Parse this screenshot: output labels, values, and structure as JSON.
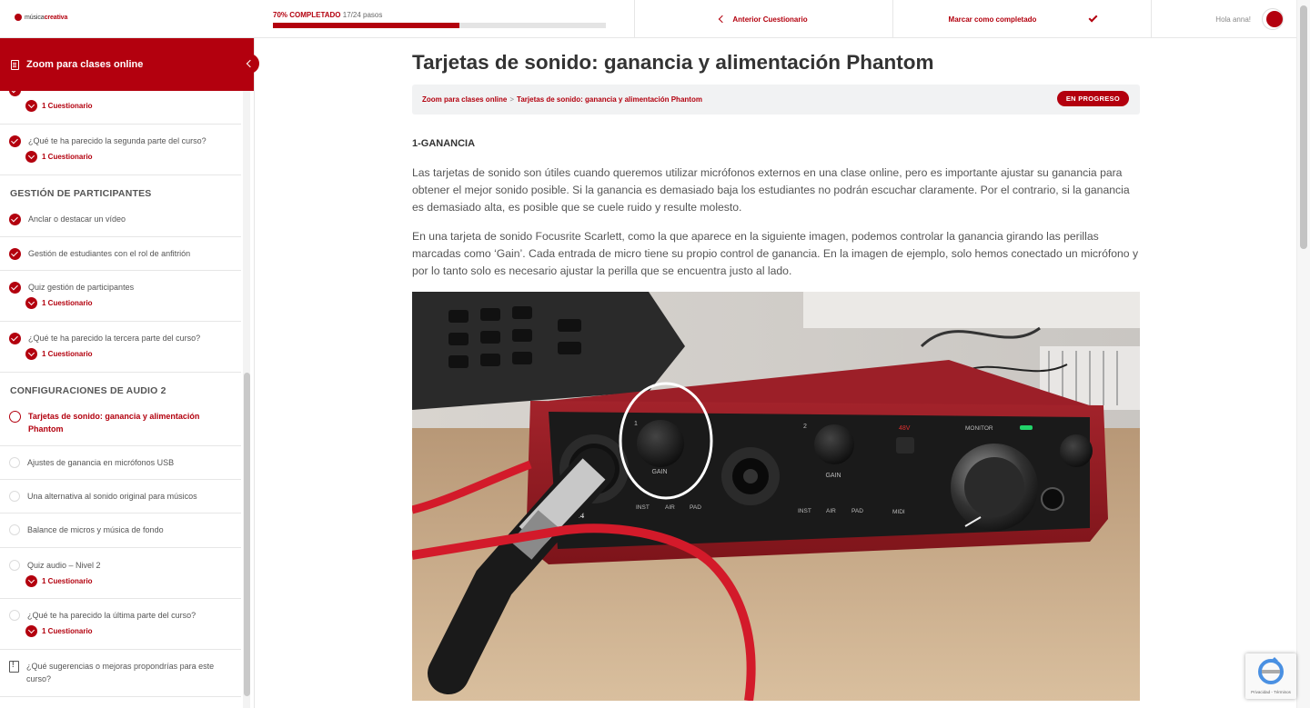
{
  "brand": {
    "logo_text_light": "música",
    "logo_text_bold": "creativa"
  },
  "progress": {
    "percent_label": "70% COMPLETADO",
    "steps_label": "17/24 pasos",
    "fraction": 0.7
  },
  "nav": {
    "prev_label": "Anterior Cuestionario",
    "complete_label": "Marcar como completado",
    "greeting": "Hola anna!"
  },
  "sidebar": {
    "course_title": "Zoom para clases online",
    "partial_top_quiz": "1 Cuestionario",
    "lessons_a": [
      {
        "title": "¿Qué te ha parecido la segunda parte del curso?",
        "quiz": "1 Cuestionario"
      }
    ],
    "section_1": "GESTIÓN DE PARTICIPANTES",
    "lessons_b": [
      {
        "title": "Anclar o destacar un vídeo"
      },
      {
        "title": "Gestión de estudiantes con el rol de anfitrión"
      },
      {
        "title": "Quiz gestión de participantes",
        "quiz": "1 Cuestionario"
      },
      {
        "title": "¿Qué te ha parecido la tercera parte del curso?",
        "quiz": "1 Cuestionario"
      }
    ],
    "section_2": "CONFIGURACIONES DE AUDIO 2",
    "lessons_c": [
      {
        "title": "Tarjetas de sonido: ganancia y alimentación Phantom"
      },
      {
        "title": "Ajustes de ganancia en micrófonos USB"
      },
      {
        "title": "Una alternativa al sonido original para músicos"
      },
      {
        "title": "Balance de micros y música de fondo"
      },
      {
        "title": "Quiz audio – Nivel 2",
        "quiz": "1 Cuestionario"
      },
      {
        "title": "¿Qué te ha parecido la última parte del curso?",
        "quiz": "1 Cuestionario"
      },
      {
        "title": "¿Qué sugerencias o mejoras propondrías para este curso?"
      }
    ]
  },
  "main": {
    "title": "Tarjetas de sonido: ganancia y alimentación Phantom",
    "breadcrumb": [
      "Zoom para clases online",
      "Tarjetas de sonido: ganancia y alimentación Phantom"
    ],
    "breadcrumb_sep": ">",
    "status": "EN PROGRESO",
    "section_heading": "1-GANANCIA",
    "paragraph_1": "Las tarjetas de sonido son útiles cuando queremos utilizar micrófonos externos en una clase online, pero es importante ajustar su ganancia para obtener el mejor sonido posible. Si la ganancia es demasiado baja los estudiantes no podrán escuchar claramente. Por el contrario, si la ganancia es demasiado alta, es posible que se cuele ruido y resulte molesto.",
    "paragraph_2": "En una tarjeta de sonido Focusrite Scarlett, como la que aparece en la siguiente imagen, podemos controlar la ganancia girando las perillas marcadas como ‘Gain’.  Cada entrada de micro tiene su propio control de ganancia. En la imagen de ejemplo, solo hemos conectado un micrófono y por lo tanto solo es necesario ajustar la perilla que se encuentra justo al lado.",
    "photo": {
      "gain_label_1": "GAIN",
      "gain_label_2": "GAIN",
      "input_1": "1",
      "input_2": "2",
      "inst": "INST",
      "air": "AIR",
      "pad": "PAD",
      "phantom": "48V",
      "monitor": "MONITOR",
      "midi": "MIDI",
      "model": "2i4"
    }
  },
  "recaptcha": {
    "footer": "Privacidad - Términos"
  }
}
